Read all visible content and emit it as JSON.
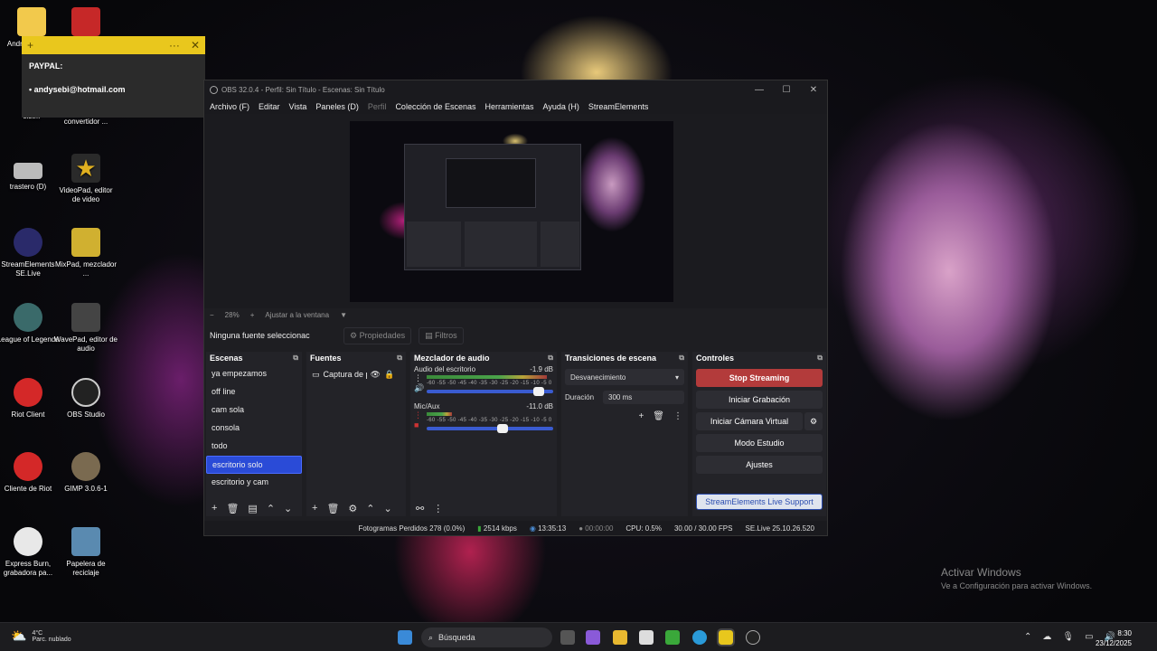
{
  "desktop": {
    "icons": [
      {
        "label": "Andre... Acce...",
        "color": "#f2c94c"
      },
      {
        "label": "",
        "color": "#c62828"
      },
      {
        "label": "sist...",
        "color": "#4a7bd0"
      },
      {
        "label": "convertidor ...",
        "color": "#555"
      },
      {
        "label": "trastero (D)",
        "color": "#bbb"
      },
      {
        "label": "VideoPad, editor de video",
        "color": "#e0b020"
      },
      {
        "label": "StreamElements SE.Live",
        "color": "#2a2a6a"
      },
      {
        "label": "MixPad, mezclador ...",
        "color": "#d0b030"
      },
      {
        "label": "League of Legends",
        "color": "#3a6a6a"
      },
      {
        "label": "WavePad, editor de audio",
        "color": "#444"
      },
      {
        "label": "Riot Client",
        "color": "#d42828"
      },
      {
        "label": "OBS Studio",
        "color": "#222"
      },
      {
        "label": "Cliente de Riot",
        "color": "#d42828"
      },
      {
        "label": "GIMP 3.0.6-1",
        "color": "#7a6a50"
      },
      {
        "label": "Express Burn, grabadora pa...",
        "color": "#e8e8e8"
      },
      {
        "label": "Papelera de reciclaje",
        "color": "#5a8ab0"
      }
    ]
  },
  "sticky": {
    "add": "+",
    "more": "···",
    "close": "✕",
    "line1": "PAYPAL:",
    "line2": "• andysebi@hotmail.com"
  },
  "obs": {
    "title": "OBS 32.0.4 - Perfil: Sin Título - Escenas: Sin Título",
    "window_controls": [
      "—",
      "☐",
      "✕"
    ],
    "menu": [
      "Archivo (F)",
      "Editar",
      "Vista",
      "Paneles (D)",
      "Perfil",
      "Colección de Escenas",
      "Herramientas",
      "Ayuda (H)",
      "StreamElements"
    ],
    "zoom": {
      "minus": "−",
      "value": "28%",
      "plus": "+",
      "fit": "Ajustar a la ventana",
      "arrow": "▼"
    },
    "source_bar": {
      "none": "Ninguna fuente seleccionac",
      "properties": "Propiedades",
      "filters": "Filtros"
    },
    "scenes": {
      "title": "Escenas",
      "items": [
        "ya empezamos",
        "off line",
        "cam sola",
        "consola",
        "todo",
        "escritorio solo",
        "escritorio y cam"
      ],
      "selected": 5
    },
    "sources": {
      "title": "Fuentes",
      "items": [
        "Captura de p"
      ]
    },
    "mixer": {
      "title": "Mezclador de audio",
      "ticks": "-60 -55 -50 -45 -40 -35 -30 -25 -20 -15 -10 -5 0",
      "channels": [
        {
          "name": "Audio del escritorio",
          "db": "-1.9 dB",
          "level": 0.95,
          "fader": 0.88
        },
        {
          "name": "Mic/Aux",
          "db": "-11.0 dB",
          "level": 0.2,
          "fader": 0.6
        }
      ]
    },
    "transitions": {
      "title": "Transiciones de escena",
      "transition": "Desvanecimiento",
      "duration_label": "Duración",
      "duration": "300 ms"
    },
    "controls": {
      "title": "Controles",
      "buttons": [
        "Stop Streaming",
        "Iniciar Grabación",
        "Iniciar Cámara Virtual",
        "Modo Estudio",
        "Ajustes"
      ],
      "support": "StreamElements Live Support"
    },
    "status": {
      "dropped": "Fotogramas Perdidos 278 (0.0%)",
      "bitrate": "2514 kbps",
      "stream_time": "13:35:13",
      "rec_time": "00:00:00",
      "cpu": "CPU: 0.5%",
      "fps": "30.00 / 30.00 FPS",
      "version": "SE.Live 25.10.26.520"
    }
  },
  "watermark": {
    "line1": "Activar Windows",
    "line2": "Ve a Configuración para activar Windows."
  },
  "taskbar": {
    "temp": "4°C",
    "weather": "Parc. nublado",
    "search": "Búsqueda",
    "time": "8:30",
    "date": "23/12/2025"
  },
  "colors": {
    "accent": "#2a4bd7",
    "stream": "#b33b3b",
    "sticky": "#e9c71d"
  }
}
